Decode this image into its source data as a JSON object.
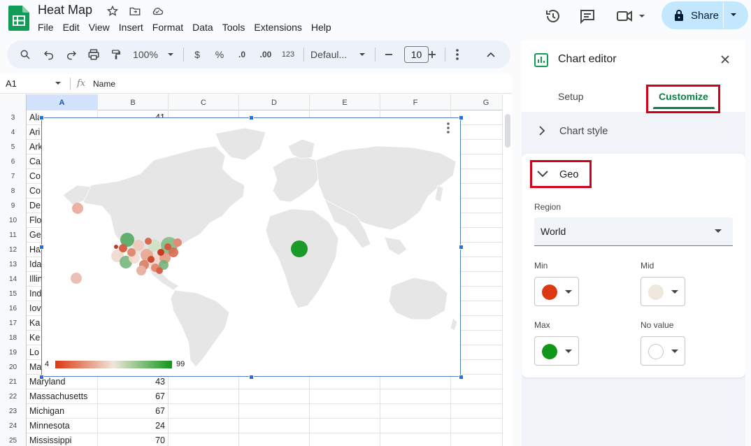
{
  "header": {
    "title": "Heat Map",
    "menu": [
      "File",
      "Edit",
      "View",
      "Insert",
      "Format",
      "Data",
      "Tools",
      "Extensions",
      "Help"
    ],
    "share_label": "Share"
  },
  "toolbar": {
    "zoom": "100%",
    "currency": "$",
    "percent": "%",
    "decrease_decimal": ".0",
    "increase_decimal": ".00",
    "number_format": "123",
    "font": "Defaul...",
    "font_size": "10"
  },
  "formula_bar": {
    "cell_ref": "A1",
    "fx": "fx",
    "value": "Name"
  },
  "sheet": {
    "columns": [
      "A",
      "B",
      "C",
      "D",
      "E",
      "F",
      "G"
    ],
    "rows": [
      {
        "num": "3",
        "a": "Ala",
        "b": "41"
      },
      {
        "num": "4",
        "a": "Ari",
        "b": ""
      },
      {
        "num": "5",
        "a": "Ark",
        "b": ""
      },
      {
        "num": "6",
        "a": "Ca",
        "b": ""
      },
      {
        "num": "7",
        "a": "Co",
        "b": ""
      },
      {
        "num": "8",
        "a": "Co",
        "b": ""
      },
      {
        "num": "9",
        "a": "De",
        "b": ""
      },
      {
        "num": "10",
        "a": "Flo",
        "b": ""
      },
      {
        "num": "11",
        "a": "Ge",
        "b": ""
      },
      {
        "num": "12",
        "a": "Ha",
        "b": ""
      },
      {
        "num": "13",
        "a": "Ida",
        "b": ""
      },
      {
        "num": "14",
        "a": "Illin",
        "b": ""
      },
      {
        "num": "15",
        "a": "Ind",
        "b": ""
      },
      {
        "num": "16",
        "a": "Iov",
        "b": ""
      },
      {
        "num": "17",
        "a": "Ka",
        "b": ""
      },
      {
        "num": "18",
        "a": "Ke",
        "b": ""
      },
      {
        "num": "19",
        "a": "Lo",
        "b": ""
      },
      {
        "num": "20",
        "a": "Ma",
        "b": ""
      },
      {
        "num": "21",
        "a": "Maryland",
        "b": "43"
      },
      {
        "num": "22",
        "a": "Massachusetts",
        "b": "67"
      },
      {
        "num": "23",
        "a": "Michigan",
        "b": "67"
      },
      {
        "num": "24",
        "a": "Minnesota",
        "b": "24"
      },
      {
        "num": "25",
        "a": "Mississippi",
        "b": "70"
      }
    ]
  },
  "chart": {
    "legend_min": "4",
    "legend_max": "99",
    "colors": {
      "min": "#dc3912",
      "mid": "#efe6dc",
      "max": "#109618"
    }
  },
  "editor": {
    "title": "Chart editor",
    "tabs": {
      "setup": "Setup",
      "customize": "Customize"
    },
    "chart_style": "Chart style",
    "geo": "Geo",
    "region_label": "Region",
    "region_value": "World",
    "min_label": "Min",
    "mid_label": "Mid",
    "max_label": "Max",
    "no_value_label": "No value",
    "colors": {
      "min": "#dc3912",
      "mid": "#efe6dc",
      "max": "#109618",
      "no_value": "#ffffff"
    }
  }
}
